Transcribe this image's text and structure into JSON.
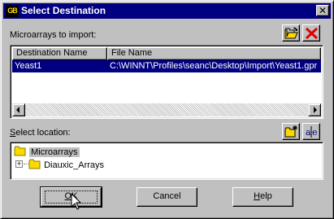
{
  "window": {
    "title": "Select Destination",
    "app_icon_text": "GB"
  },
  "microarrays": {
    "label": "Microarrays to import:",
    "columns": [
      "Destination Name",
      "File Name"
    ],
    "rows": [
      {
        "destination": "Yeast1",
        "file": "C:\\WINNT\\Profiles\\seanc\\Desktop\\Import\\Yeast1.gpr"
      }
    ]
  },
  "location": {
    "label_prefix": "",
    "label_underline": "S",
    "label_rest": "elect location:",
    "tree": [
      {
        "label": "Microarrays",
        "selected": true,
        "level": 0
      },
      {
        "label": "Diauxic_Arrays",
        "selected": false,
        "level": 1,
        "expander": "+"
      }
    ]
  },
  "buttons": {
    "ok_underline": "O",
    "ok_rest": "K",
    "cancel": "Cancel",
    "help_underline": "H",
    "help_rest": "elp"
  },
  "icons": {
    "open": "folder-open-icon",
    "remove": "red-x-icon",
    "new_folder": "new-folder-icon",
    "rename": "rename-icon"
  }
}
